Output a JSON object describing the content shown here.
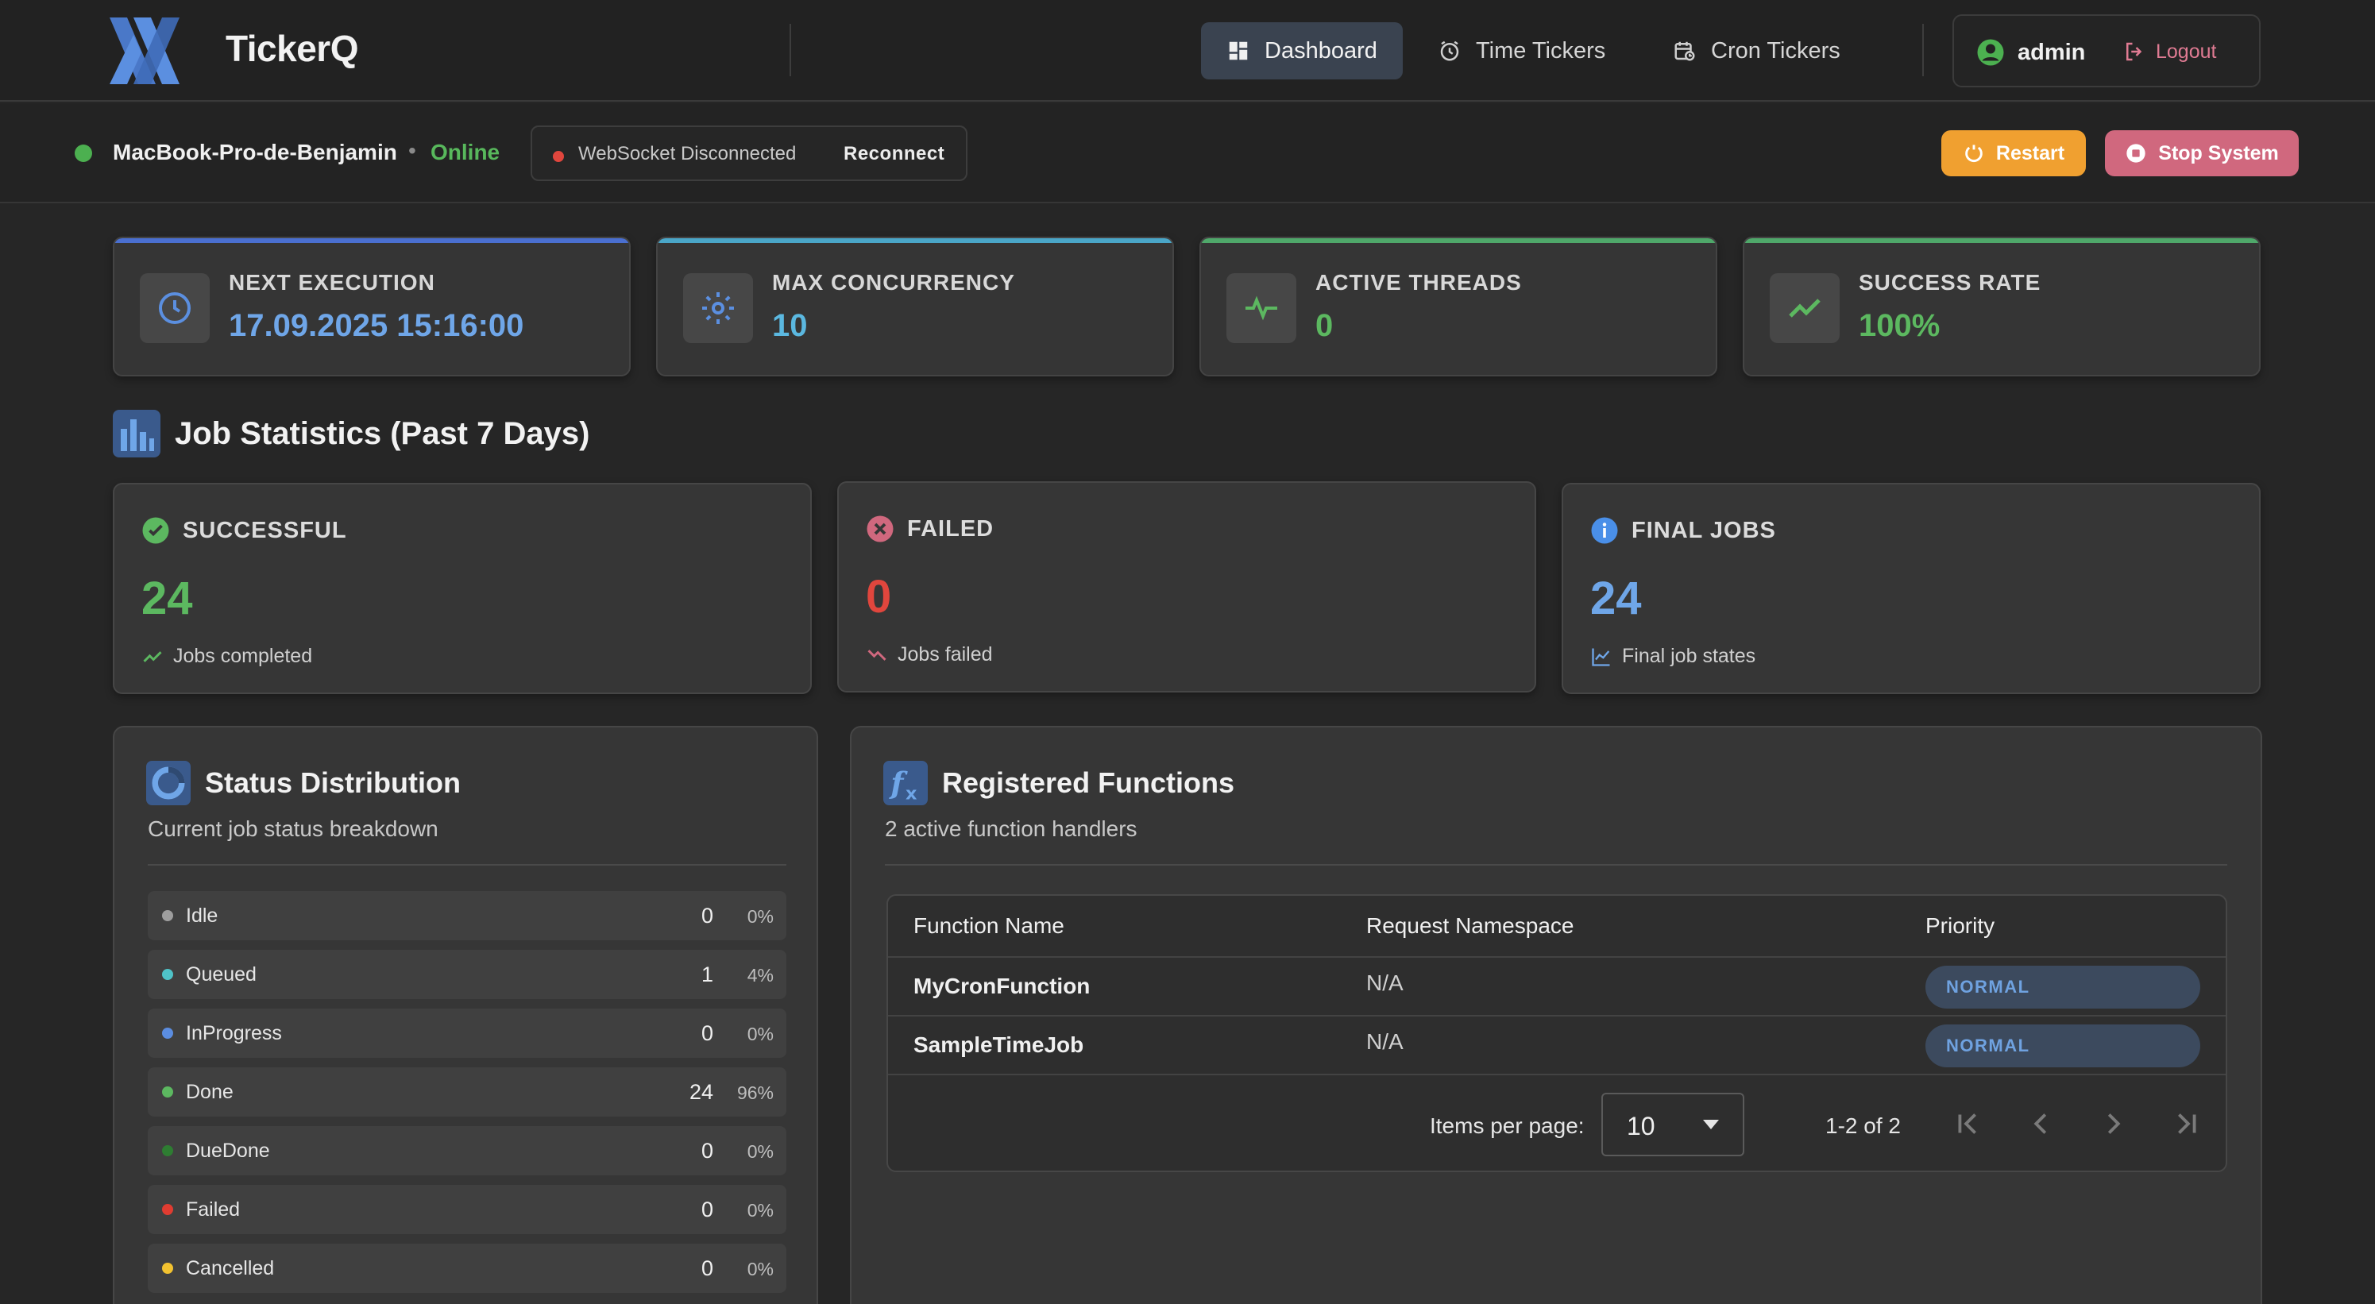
{
  "app": {
    "name": "TickerQ"
  },
  "nav": {
    "items": [
      {
        "label": "Dashboard",
        "icon": "dashboard-icon",
        "active": true
      },
      {
        "label": "Time Tickers",
        "icon": "alarm-clock-icon",
        "active": false
      },
      {
        "label": "Cron Tickers",
        "icon": "calendar-clock-icon",
        "active": false
      }
    ],
    "user": "admin",
    "logout": "Logout"
  },
  "status": {
    "host": "MacBook-Pro-de-Benjamin",
    "separator": "•",
    "online": "Online",
    "websocket": "WebSocket Disconnected",
    "reconnect": "Reconnect",
    "restart": "Restart",
    "stop": "Stop System"
  },
  "stats": [
    {
      "label": "NEXT EXECUTION",
      "value": "17.09.2025 15:16:00",
      "icon": "clock-icon",
      "color": "#6fa6e8",
      "accent": "#4a6fd0"
    },
    {
      "label": "MAX CONCURRENCY",
      "value": "10",
      "icon": "gear-icon",
      "color": "#5bb8e0",
      "accent": "#4aa6c8"
    },
    {
      "label": "ACTIVE THREADS",
      "value": "0",
      "icon": "pulse-icon",
      "color": "#5cb860",
      "accent": "#4fa86a"
    },
    {
      "label": "SUCCESS RATE",
      "value": "100%",
      "icon": "trending-up-icon",
      "color": "#5cb860",
      "accent": "#4fa86a"
    }
  ],
  "job_statistics": {
    "title": "Job Statistics (Past 7 Days)",
    "cards": [
      {
        "label": "SUCCESSFUL",
        "value": "24",
        "sub": "Jobs completed",
        "icon": "check-circle-icon",
        "color": "#5cb860"
      },
      {
        "label": "FAILED",
        "value": "0",
        "sub": "Jobs failed",
        "icon": "x-circle-icon",
        "color": "#e0463d"
      },
      {
        "label": "FINAL JOBS",
        "value": "24",
        "sub": "Final job states",
        "icon": "info-icon",
        "color": "#6fa6e8"
      }
    ]
  },
  "status_distribution": {
    "title": "Status Distribution",
    "subtitle": "Current job status breakdown",
    "rows": [
      {
        "name": "Idle",
        "count": "0",
        "pct": "0%",
        "color": "#9e9e9e"
      },
      {
        "name": "Queued",
        "count": "1",
        "pct": "4%",
        "color": "#4fc3c8"
      },
      {
        "name": "InProgress",
        "count": "0",
        "pct": "0%",
        "color": "#5b8de0"
      },
      {
        "name": "Done",
        "count": "24",
        "pct": "96%",
        "color": "#5cb860"
      },
      {
        "name": "DueDone",
        "count": "0",
        "pct": "0%",
        "color": "#2e7d32"
      },
      {
        "name": "Failed",
        "count": "0",
        "pct": "0%",
        "color": "#e03c31"
      },
      {
        "name": "Cancelled",
        "count": "0",
        "pct": "0%",
        "color": "#f2c230"
      }
    ]
  },
  "registered_functions": {
    "title": "Registered Functions",
    "subtitle": "2 active function handlers",
    "columns": [
      "Function Name",
      "Request Namespace",
      "Priority"
    ],
    "rows": [
      {
        "name": "MyCronFunction",
        "namespace": "N/A",
        "priority": "NORMAL"
      },
      {
        "name": "SampleTimeJob",
        "namespace": "N/A",
        "priority": "NORMAL"
      }
    ],
    "pagination": {
      "label": "Items per page:",
      "per_page": "10",
      "range": "1-2 of 2"
    }
  }
}
